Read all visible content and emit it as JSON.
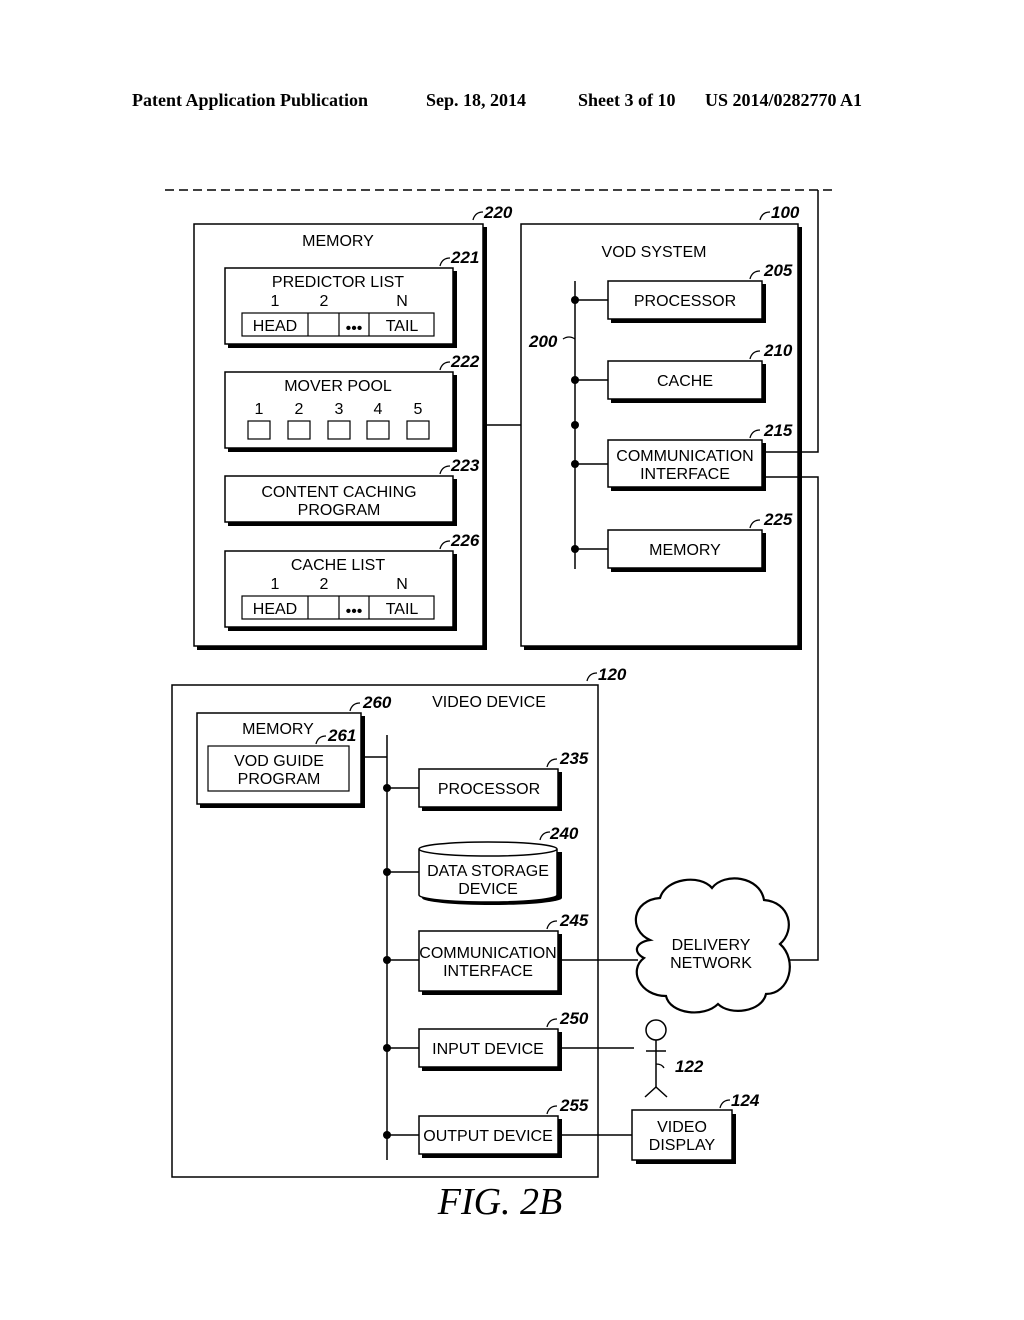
{
  "header": {
    "publication": "Patent Application Publication",
    "date": "Sep. 18, 2014",
    "sheet": "Sheet 3 of 10",
    "number": "US 2014/0282770 A1"
  },
  "figure_label": "FIG. 2B",
  "memory_220": {
    "ref": "220",
    "title": "MEMORY",
    "predictor_list": {
      "ref": "221",
      "title": "PREDICTOR LIST",
      "index_1": "1",
      "index_2": "2",
      "index_n": "N",
      "head": "HEAD",
      "ellipsis": "•••",
      "tail": "TAIL"
    },
    "mover_pool": {
      "ref": "222",
      "title": "MOVER POOL",
      "slots": [
        "1",
        "2",
        "3",
        "4",
        "5"
      ]
    },
    "content_caching_program": {
      "ref": "223",
      "line1": "CONTENT CACHING",
      "line2": "PROGRAM"
    },
    "cache_list": {
      "ref": "226",
      "title": "CACHE LIST",
      "index_1": "1",
      "index_2": "2",
      "index_n": "N",
      "head": "HEAD",
      "ellipsis": "•••",
      "tail": "TAIL"
    }
  },
  "vod_system": {
    "ref": "100",
    "title": "VOD SYSTEM",
    "bus_ref": "200",
    "processor": {
      "ref": "205",
      "label": "PROCESSOR"
    },
    "cache": {
      "ref": "210",
      "label": "CACHE"
    },
    "comm_interface": {
      "ref": "215",
      "line1": "COMMUNICATION",
      "line2": "INTERFACE"
    },
    "memory": {
      "ref": "225",
      "label": "MEMORY"
    }
  },
  "video_device": {
    "ref": "120",
    "title": "VIDEO DEVICE",
    "memory": {
      "ref": "260",
      "label": "MEMORY"
    },
    "vod_guide": {
      "ref": "261",
      "line1": "VOD GUIDE",
      "line2": "PROGRAM"
    },
    "processor": {
      "ref": "235",
      "label": "PROCESSOR"
    },
    "data_storage": {
      "ref": "240",
      "line1": "DATA STORAGE",
      "line2": "DEVICE"
    },
    "comm_interface": {
      "ref": "245",
      "line1": "COMMUNICATION",
      "line2": "INTERFACE"
    },
    "input_device": {
      "ref": "250",
      "label": "INPUT DEVICE"
    },
    "output_device": {
      "ref": "255",
      "label": "OUTPUT DEVICE"
    }
  },
  "delivery_network": {
    "line1": "DELIVERY",
    "line2": "NETWORK"
  },
  "user": {
    "ref": "122"
  },
  "video_display": {
    "ref": "124",
    "line1": "VIDEO",
    "line2": "DISPLAY"
  }
}
